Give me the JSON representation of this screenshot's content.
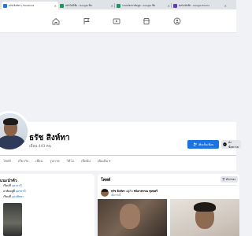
{
  "browser": {
    "tabs": [
      {
        "title": "ธรัช สิงห์ทา | Facebook",
        "icon": "facebook-icon",
        "color": "#1877f2",
        "active": true
      },
      {
        "title": "หน้าไม่มีชื่อ - Google ชีต",
        "icon": "sheets-icon",
        "color": "#0f9d58",
        "active": false
      },
      {
        "title": "ระบบจัดการข้อมูล - Google ชีต",
        "icon": "sheets-icon",
        "color": "#0f9d58",
        "active": false
      },
      {
        "title": "ฟอร์มบันทึก - Google Forms",
        "icon": "forms-icon",
        "color": "#673ab7",
        "active": false
      }
    ]
  },
  "nav": {
    "icons": [
      "home-icon",
      "flag-icon",
      "video-icon",
      "marketplace-icon",
      "groups-icon"
    ]
  },
  "profile": {
    "name": "ธรัช สิงห์ทา",
    "friends": "เพื่อน 443 คน",
    "add_friend_label": "เพิ่มเป็นเพื่อน",
    "message_label": "ส่งข้อความ"
  },
  "tabs": [
    "โพสต์",
    "เกี่ยวกับ",
    "เพื่อน",
    "รูปภาพ",
    "วิดีโอ",
    "เช็คอิน",
    "เพิ่มเติม ▾"
  ],
  "intro": {
    "title": "แนะนำตัว",
    "rows": [
      {
        "prefix": "เรียนที่ ",
        "link": "อุดรธานี"
      },
      {
        "prefix": "อาศัยอยู่ที่ ",
        "link": "อุดรธานี"
      },
      {
        "prefix": "เรียนที่ ",
        "link": "อุดมพิทยา"
      },
      {
        "prefix": "",
        "link": ""
      }
    ]
  },
  "posts": {
    "title": "โพสต์",
    "filter_label": "ตัวกรอง",
    "author": "ธรัช สิงห์ทา",
    "with_prefix": " อยู่กับ ",
    "with_name": "ชนิดาพรรณ พุทธศรี",
    "date": "เมื่อวานนี้"
  },
  "colors": {
    "brand": "#1b74e4",
    "background": "#f0f2f5"
  }
}
